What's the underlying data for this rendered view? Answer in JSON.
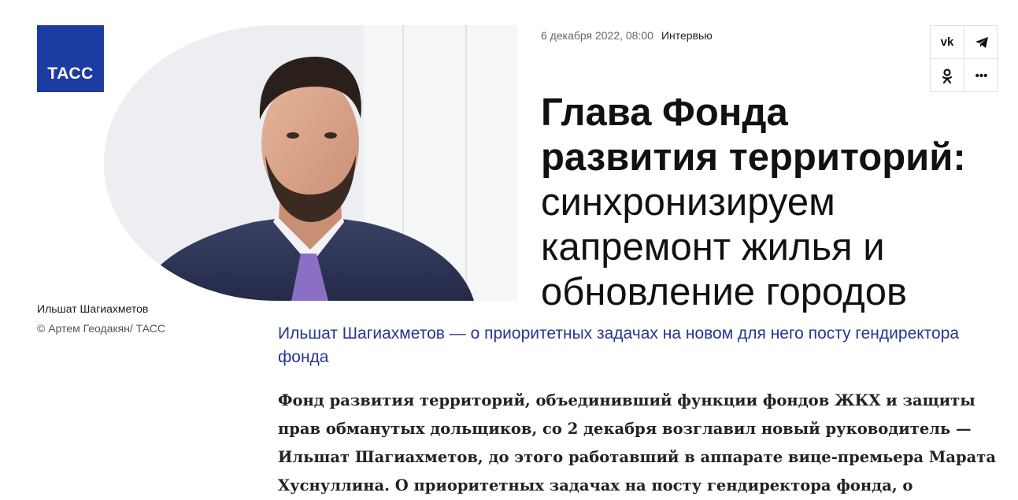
{
  "brand": {
    "logo_text": "ТАСС",
    "color": "#1d3ca2"
  },
  "article": {
    "date": "6 декабря 2022, 08:00",
    "rubric": "Интервью",
    "title_bold_1": "Глава Фонда",
    "title_bold_2": "развития территорий:",
    "title_light": "синхронизируем капремонт жилья и обновление городов",
    "lead": "Ильшат Шагиахметов — о приоритетных задачах на новом для него посту гендиректора фонда",
    "body": "Фонд развития территорий, объединивший функции фондов ЖКХ и защиты прав обманутых дольщиков, со 2 декабря возглавил новый руководитель — Ильшат Шагиахметов, до этого работавший в аппарате вице-премьера Марата Хуснуллина. О приоритетных задачах на посту гендиректора фонда, о"
  },
  "photo": {
    "caption": "Ильшат Шагиахметов",
    "credit": "© Артем Геодакян/ ТАСС"
  },
  "share": {
    "vk": "vk",
    "telegram_icon": "telegram-icon",
    "ok_icon": "odnoklassniki-icon",
    "more": "•••"
  },
  "colors": {
    "lead": "#283593",
    "text": "#222222"
  }
}
